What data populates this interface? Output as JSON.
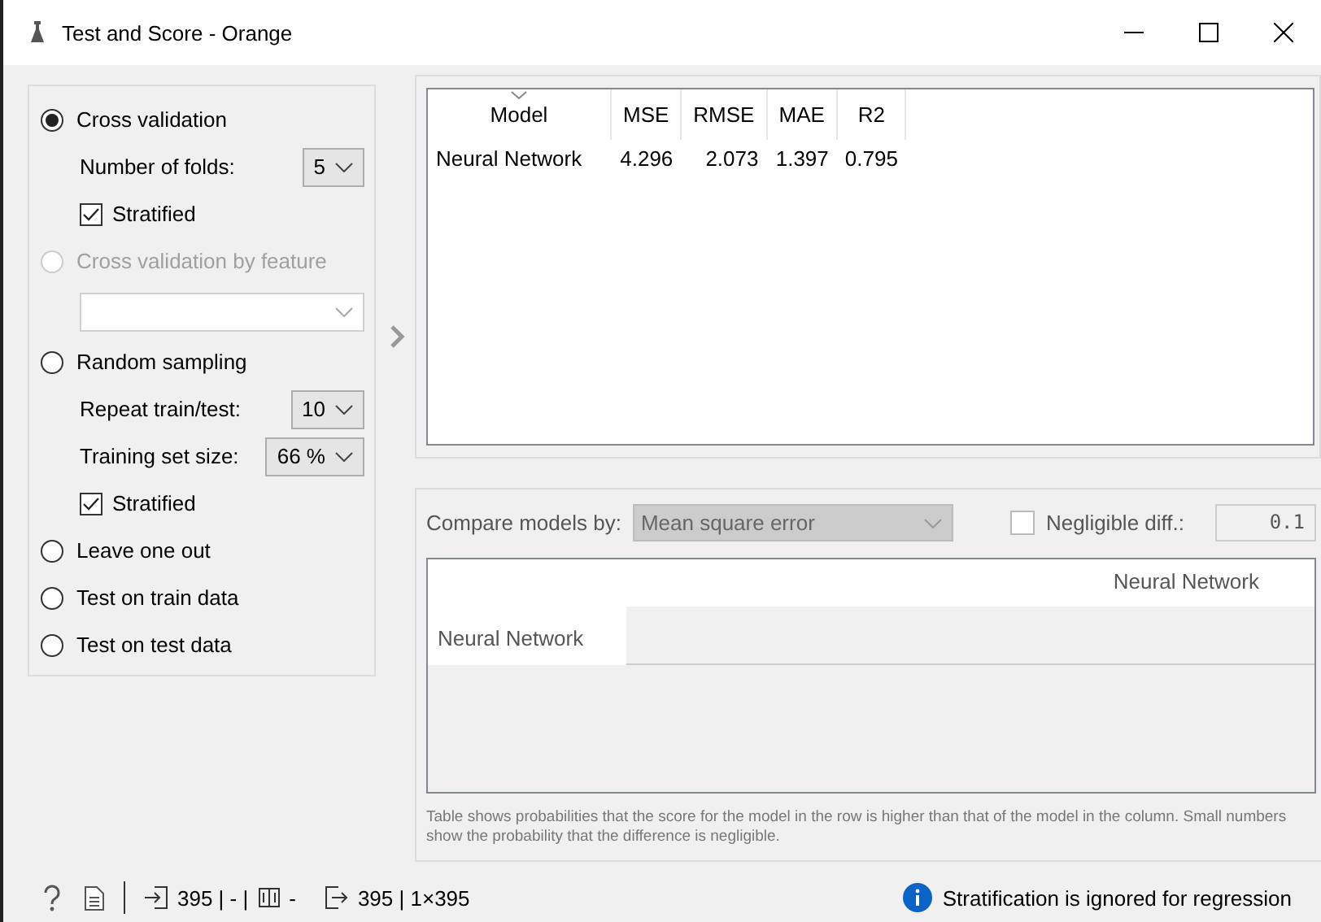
{
  "window": {
    "title": "Test and Score - Orange"
  },
  "sampling": [
    {
      "kind": "radio",
      "label": "Cross validation",
      "selected": true,
      "disabled": false
    },
    {
      "kind": "dropdown",
      "label": "Number of folds:",
      "value": "5"
    },
    {
      "kind": "checkbox",
      "label": "Stratified",
      "checked": true
    },
    {
      "kind": "radio",
      "label": "Cross validation by feature",
      "selected": false,
      "disabled": true
    },
    {
      "kind": "dropdown"
    },
    {
      "kind": "radio",
      "label": "Random sampling",
      "selected": false,
      "disabled": false
    },
    {
      "kind": "dropdown",
      "label": "Repeat train/test:",
      "value": "10"
    },
    {
      "kind": "dropdown",
      "label": "Training set size:",
      "value": "66 %"
    },
    {
      "kind": "checkbox",
      "label": "Stratified",
      "checked": true
    },
    {
      "kind": "radio",
      "label": "Leave one out",
      "selected": false,
      "disabled": false
    },
    {
      "kind": "radio",
      "label": "Test on train data",
      "selected": false,
      "disabled": false
    },
    {
      "kind": "radio",
      "label": "Test on test data",
      "selected": false,
      "disabled": false
    }
  ],
  "results": {
    "columns": [
      {
        "label": "Model",
        "sorted": true
      },
      {
        "label": "MSE",
        "sorted": false
      },
      {
        "label": "RMSE",
        "sorted": false
      },
      {
        "label": "MAE",
        "sorted": false
      },
      {
        "label": "R2",
        "sorted": false
      }
    ],
    "rows": [
      [
        "Neural Network",
        "4.296",
        "2.073",
        "1.397",
        "0.795"
      ]
    ]
  },
  "comparison": {
    "label": "Compare models by:",
    "value": "Mean square error",
    "disabled": true,
    "negligible": {
      "label": "Negligible diff.:",
      "checked": false,
      "value": "0.1"
    },
    "columns": [
      "Neural Network"
    ],
    "rows": [
      "Neural Network"
    ],
    "note": "Table shows probabilities that the score for the model in the row is higher than that of the model in the column. Small numbers show the probability that the difference is negligible."
  },
  "status_bar": {
    "input": "395 | - |",
    "input_extra": "-",
    "output": "395 | 1×395",
    "message": "Stratification is ignored for regression"
  }
}
